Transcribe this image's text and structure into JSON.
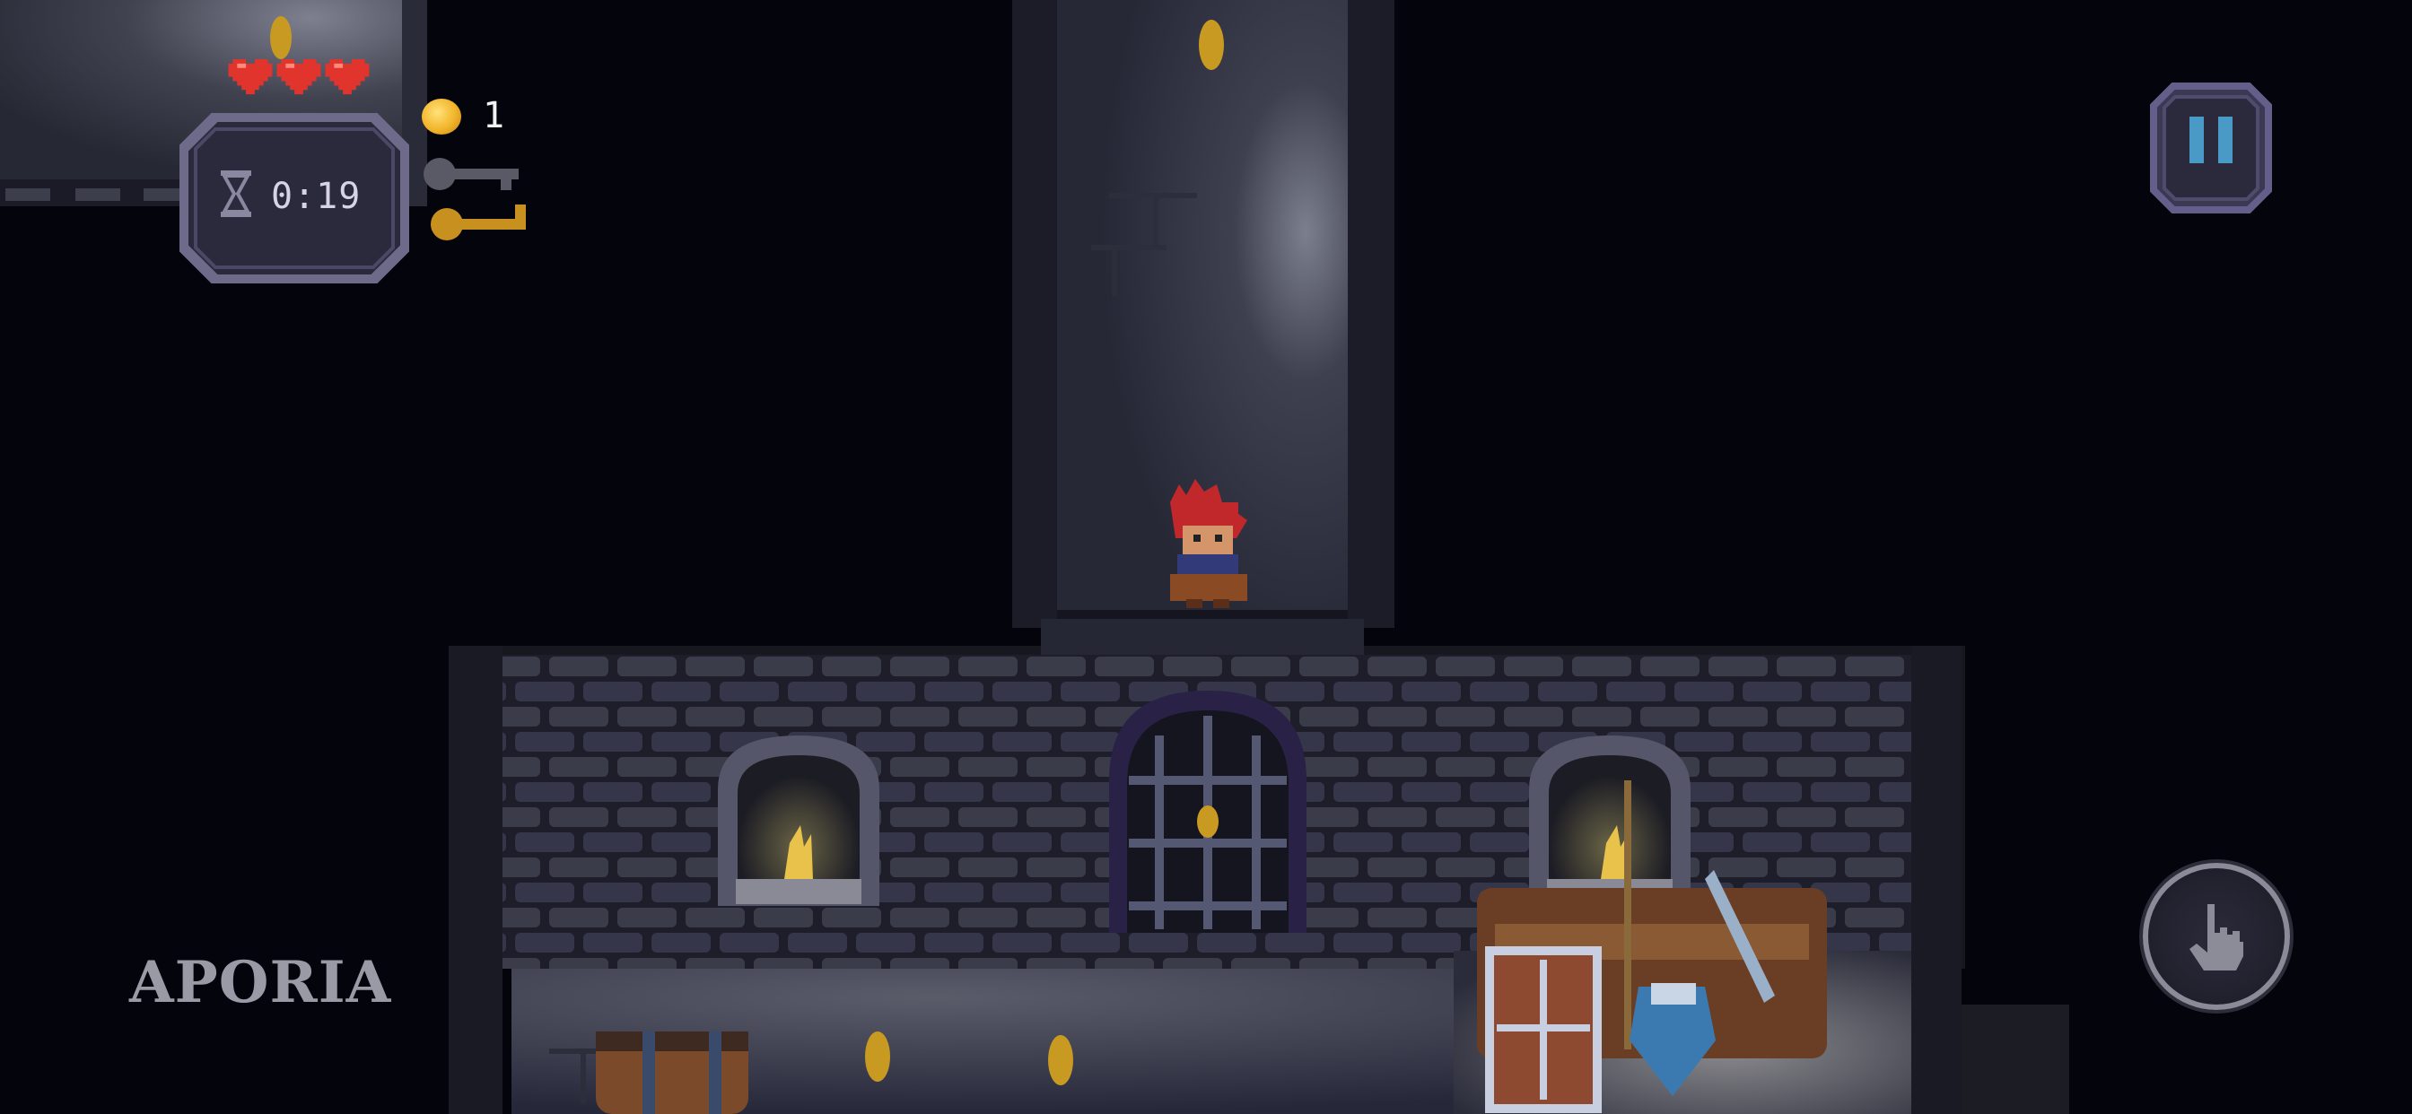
{
  "hud": {
    "lives": 3,
    "timer": "0:19",
    "coins": "1",
    "keys": [
      {
        "name": "silver-key",
        "collected": false
      },
      {
        "name": "gold-key",
        "collected": true
      }
    ]
  },
  "controls": {
    "pause_icon": "pause-icon",
    "action_icon": "hand-pointer-icon"
  },
  "watermark": "APORIA",
  "colors": {
    "heart": "#e0342c",
    "coin": "#f2b429",
    "gold_key": "#c8901e",
    "silver_key": "#5a5a66",
    "hud_frame": "#6e6a8a",
    "hud_panel": "#2b2a3c",
    "pause_frame": "#62608a",
    "pause_bars": "#4a9ac8"
  }
}
